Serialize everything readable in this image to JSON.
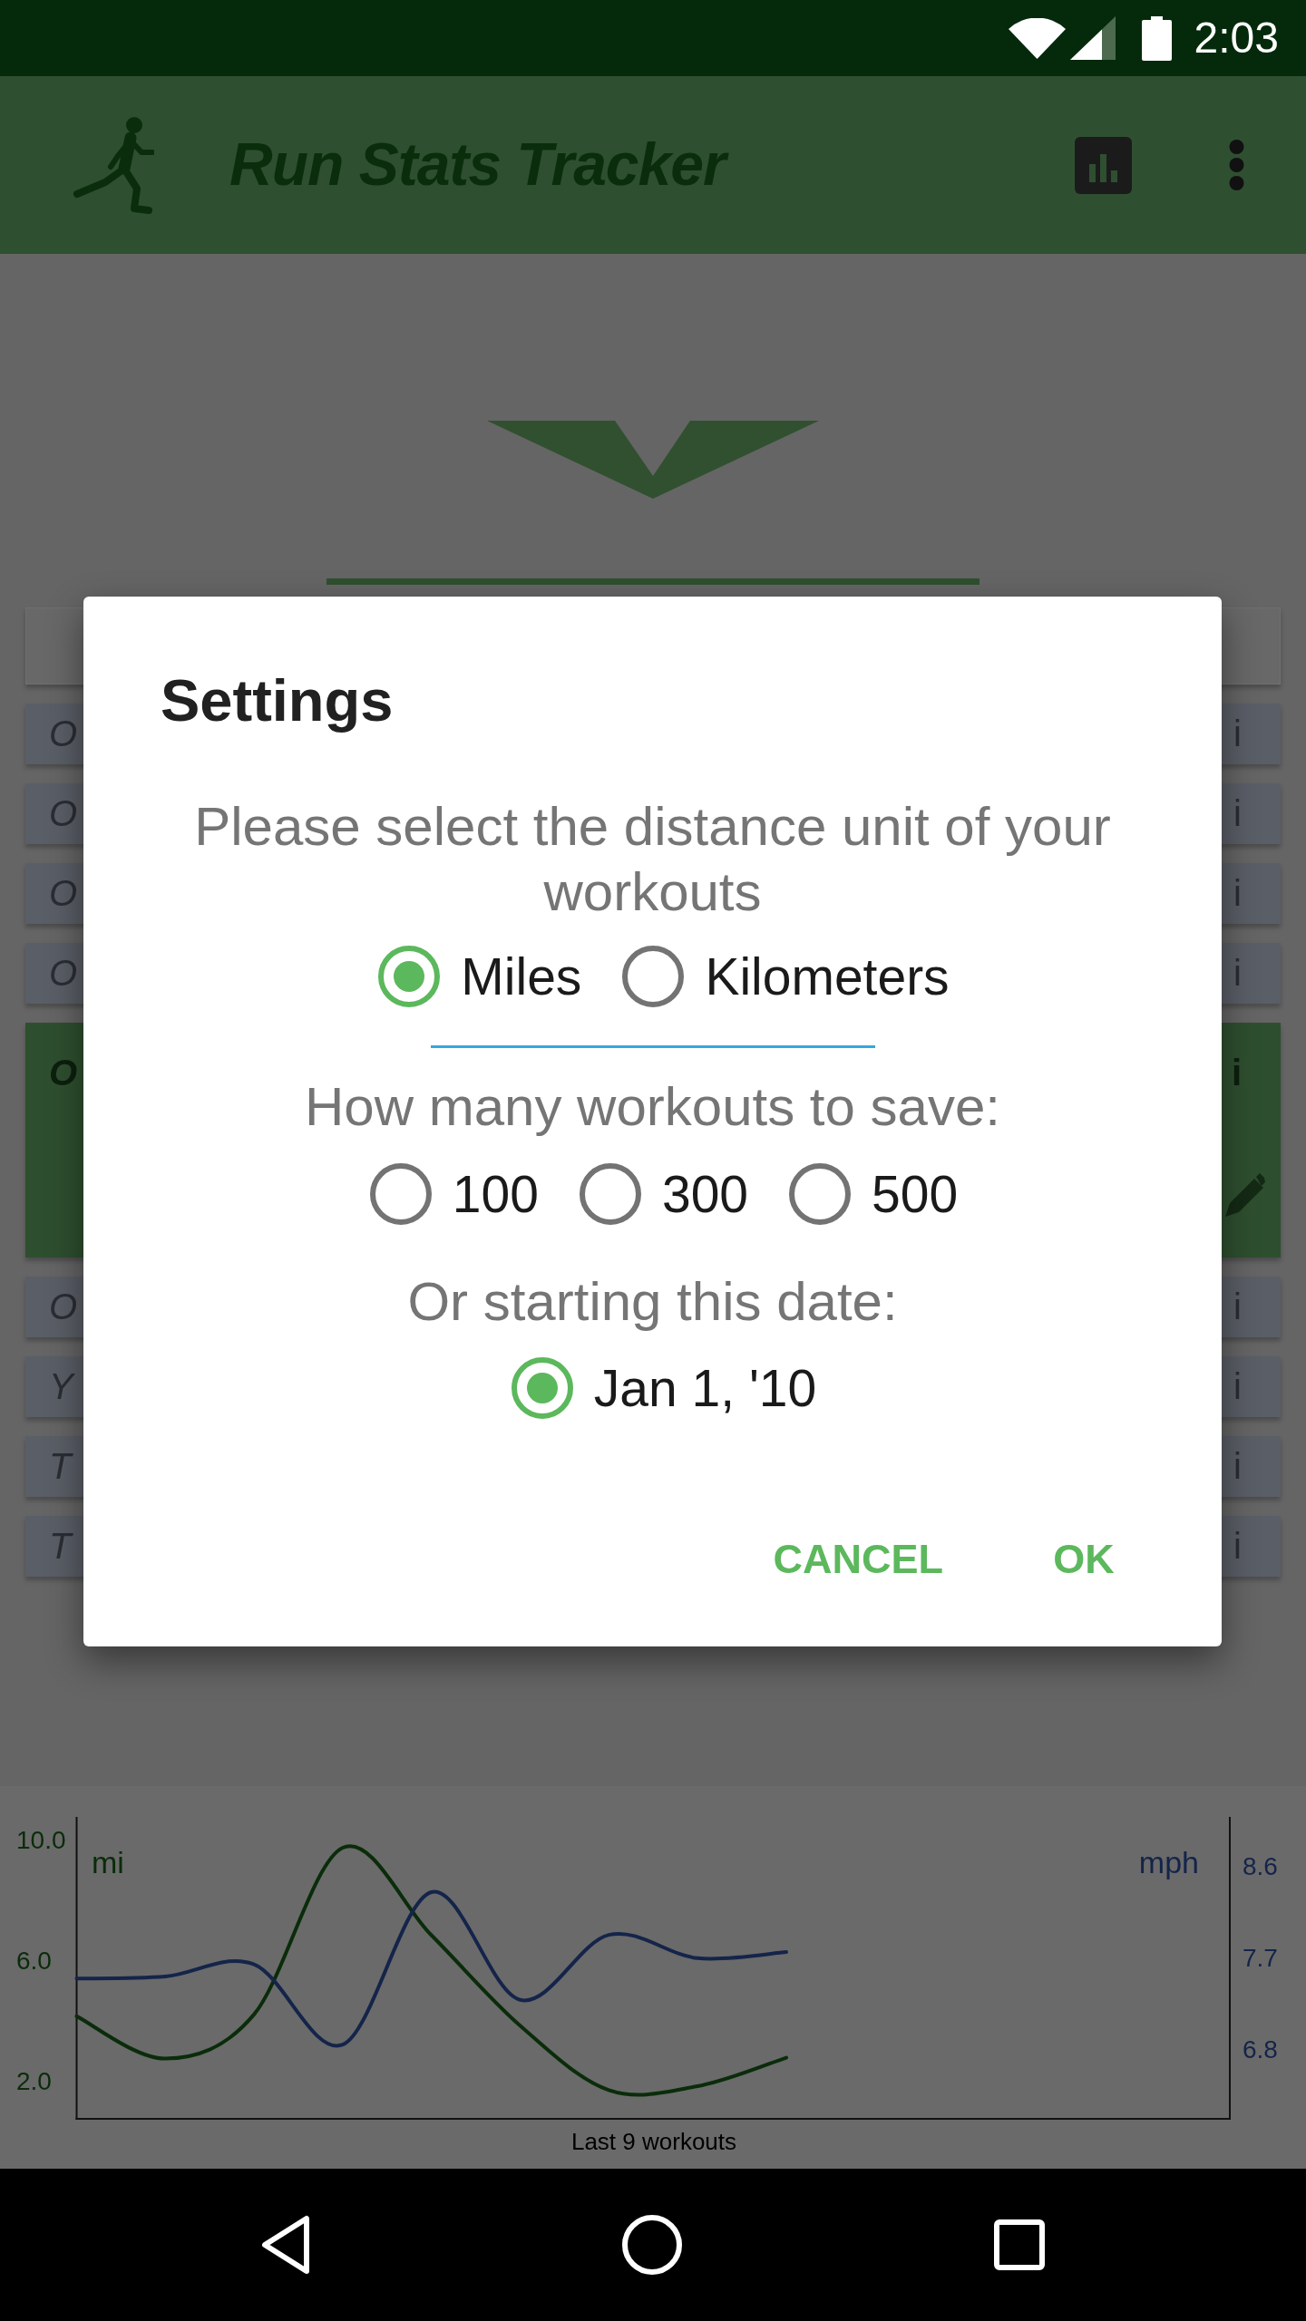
{
  "status_bar": {
    "time": "2:03"
  },
  "app_bar": {
    "title": "Run Stats Tracker"
  },
  "workout_list": {
    "rows": [
      {
        "column_1": "O",
        "column_2": "i",
        "selected": false
      },
      {
        "column_1": "O",
        "column_2": "i",
        "selected": false
      },
      {
        "column_1": "O",
        "column_2": "i",
        "selected": false
      },
      {
        "column_1": "O",
        "column_2": "i",
        "selected": false
      },
      {
        "column_1": "O",
        "column_2": "i",
        "selected": true
      },
      {
        "column_1": "O",
        "column_2": "i",
        "selected": false
      },
      {
        "column_1": "Y",
        "column_2": "i",
        "selected": false
      },
      {
        "column_1": "T",
        "column_2": "i",
        "selected": false
      },
      {
        "column_1": "T",
        "column_2": "i",
        "selected": false
      }
    ]
  },
  "chart": {
    "chart_data": {
      "type": "line",
      "xlabel": "Last 9 workouts",
      "categories": [
        null,
        null,
        null,
        null,
        null,
        null,
        null,
        null,
        null,
        null,
        null,
        null,
        null,
        null
      ],
      "ylim": [
        0.77,
        10.75
      ],
      "yticks": [
        {
          "value": 10,
          "label": "10.0"
        },
        {
          "value": 6,
          "label": "6.0"
        },
        {
          "value": 2,
          "label": "2.0"
        }
      ],
      "y2lim": [
        6.12,
        9.09
      ],
      "y2ticks": [
        {
          "value": 8.6,
          "label": "8.6"
        },
        {
          "value": 7.7,
          "label": "7.7"
        },
        {
          "value": 6.8,
          "label": "6.8"
        }
      ],
      "series": [
        {
          "name": "mi",
          "color": "#0a2c0a",
          "values": [
            4.16,
            2.76,
            4.22,
            9.73,
            6.84,
            3.85,
            1.72,
            1.85,
            2.79,
            null,
            null,
            null,
            null,
            null
          ]
        },
        {
          "name": "mph",
          "color": "#14244a",
          "axis": "y2",
          "values": [
            7.5,
            7.52,
            7.64,
            6.85,
            8.35,
            7.29,
            7.93,
            7.7,
            7.76,
            null,
            null,
            null,
            null,
            null
          ]
        }
      ]
    }
  },
  "dialog": {
    "title": "Settings",
    "unit_prompt": "Please select the distance unit of your workouts",
    "unit_options": [
      {
        "label": "Miles",
        "selected": true
      },
      {
        "label": "Kilometers",
        "selected": false
      }
    ],
    "count_prompt": "How many workouts to save:",
    "count_options": [
      {
        "label": "100",
        "selected": false
      },
      {
        "label": "300",
        "selected": false
      },
      {
        "label": "500",
        "selected": false
      }
    ],
    "date_prompt": "Or starting this date:",
    "date_options": [
      {
        "label": "Jan 1, '10",
        "selected": true
      }
    ],
    "buttons": [
      "CANCEL",
      "OK"
    ]
  }
}
